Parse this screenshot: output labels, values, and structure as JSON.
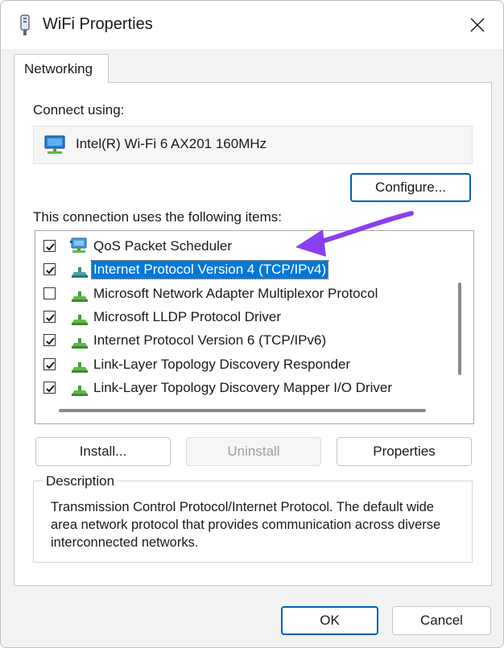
{
  "window": {
    "title": "WiFi Properties",
    "accent_color": "#005fb8",
    "selection_color": "#0078d7"
  },
  "tabs": [
    {
      "label": "Networking",
      "active": true
    }
  ],
  "connect": {
    "label": "Connect using:",
    "adapter_name": "Intel(R) Wi-Fi 6 AX201 160MHz",
    "adapter_icon": "network-adapter-icon"
  },
  "buttons": {
    "configure": "Configure...",
    "install": "Install...",
    "uninstall": "Uninstall",
    "properties": "Properties",
    "ok": "OK",
    "cancel": "Cancel"
  },
  "items_label": "This connection uses the following items:",
  "items": [
    {
      "label": "QoS Packet Scheduler",
      "checked": true,
      "selected": false,
      "icon": "service-icon"
    },
    {
      "label": "Internet Protocol Version 4 (TCP/IPv4)",
      "checked": true,
      "selected": true,
      "icon": "protocol-icon"
    },
    {
      "label": "Microsoft Network Adapter Multiplexor Protocol",
      "checked": false,
      "selected": false,
      "icon": "protocol-icon"
    },
    {
      "label": "Microsoft LLDP Protocol Driver",
      "checked": true,
      "selected": false,
      "icon": "protocol-icon"
    },
    {
      "label": "Internet Protocol Version 6 (TCP/IPv6)",
      "checked": true,
      "selected": false,
      "icon": "protocol-icon"
    },
    {
      "label": "Link-Layer Topology Discovery Responder",
      "checked": true,
      "selected": false,
      "icon": "protocol-icon"
    },
    {
      "label": "Link-Layer Topology Discovery Mapper I/O Driver",
      "checked": true,
      "selected": false,
      "icon": "protocol-icon"
    }
  ],
  "description": {
    "title": "Description",
    "text": "Transmission Control Protocol/Internet Protocol. The default wide area network protocol that provides communication across diverse interconnected networks."
  },
  "annotation": {
    "arrow_color": "#8a3ff0"
  }
}
